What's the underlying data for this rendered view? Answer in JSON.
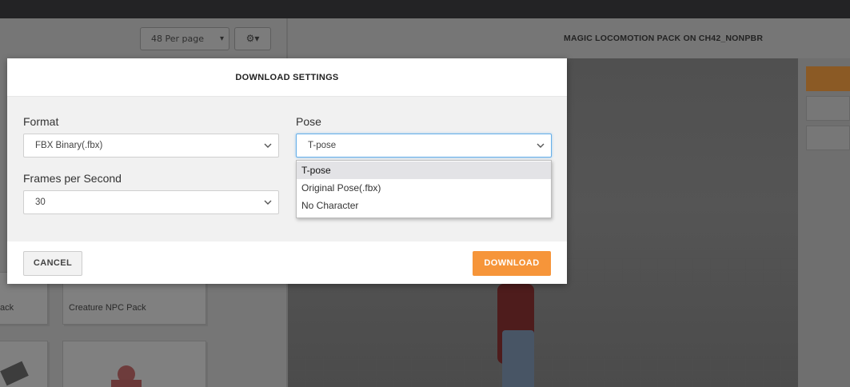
{
  "library": {
    "per_page": "48 Per page",
    "cards": [
      {
        "label": "ack"
      },
      {
        "label": "Creature NPC Pack"
      }
    ]
  },
  "viewer": {
    "title": "MAGIC LOCOMOTION PACK ON CH42_NONPBR"
  },
  "modal": {
    "title": "DOWNLOAD SETTINGS",
    "format": {
      "label": "Format",
      "value": "FBX Binary(.fbx)"
    },
    "pose": {
      "label": "Pose",
      "value": "T-pose",
      "options": [
        "T-pose",
        "Original Pose(.fbx)",
        "No Character"
      ],
      "selected_index": 0
    },
    "fps": {
      "label": "Frames per Second",
      "value": "30"
    },
    "cancel_label": "CANCEL",
    "download_label": "DOWNLOAD"
  },
  "colors": {
    "accent_orange": "#f6953a",
    "focus_blue": "#66afe9",
    "overlay_dim": "#767676",
    "topbar": "#232325"
  },
  "icons": {
    "gear": "gear-icon",
    "chevron": "chevron-down-icon",
    "caret": "caret-down-icon"
  }
}
